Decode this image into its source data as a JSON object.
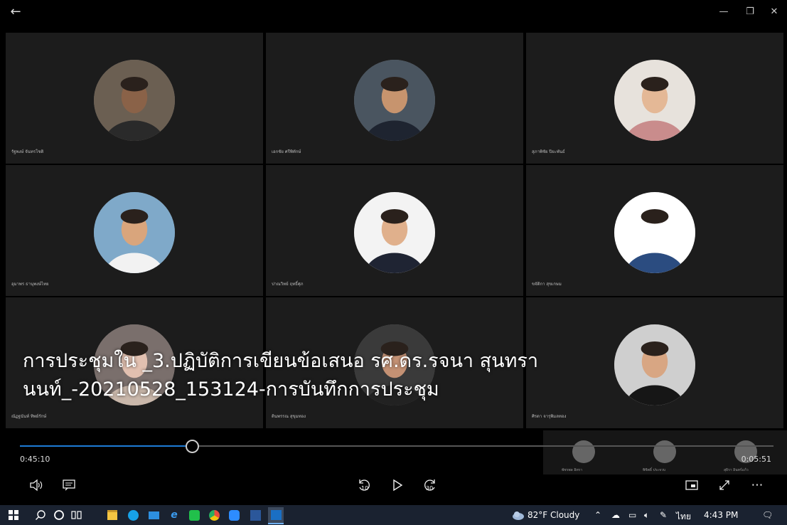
{
  "window": {
    "back_icon": "arrow-left-icon",
    "minimize_icon": "minimize-icon",
    "restore_icon": "restore-icon",
    "close_icon": "close-icon"
  },
  "participants": [
    {
      "name": "รัฐพงษ์ จันทรโชติ",
      "bg": "#6b5f52",
      "skin": "#8a6248",
      "shirt": "#2a2a2a"
    },
    {
      "name": "เอกชัย ศรีพิทักษ์",
      "bg": "#4a5560",
      "skin": "#c7946e",
      "shirt": "#1e2430"
    },
    {
      "name": "สุภาพิชัย ปิยะพันธ์",
      "bg": "#e7e2dc",
      "skin": "#e4b896",
      "shirt": "#c98c8c"
    },
    {
      "name": "อุมาพร ธานุพงษ์ไทย",
      "bg": "#7fa9c9",
      "skin": "#d9a57c",
      "shirt": "#f2f2f2"
    },
    {
      "name": "ปาณวิทย์ ฤทธิ์ศุภ",
      "bg": "#f3f3f3",
      "skin": "#e0b08c",
      "shirt": "#1f2433"
    },
    {
      "name": "ขจัติกา สุขเกษม",
      "bg": "#ffffff",
      "skin": "#ffffff",
      "shirt": "#2b4c80"
    },
    {
      "name": "ณัฏฐนันท์ ทิพย์รักษ์",
      "bg": "#7a6f6c",
      "skin": "#e2c0b0",
      "shirt": "#c9b7aa"
    },
    {
      "name": "ตินพรรณ สุขุมทอง",
      "bg": "#3a3a3a",
      "skin": "#c49174",
      "shirt": "#222"
    },
    {
      "name": "ศิรดา จารุพิมลทอง",
      "bg": "#cfcfcf",
      "skin": "#d8a683",
      "shirt": "#161616"
    }
  ],
  "video_title": "การประชุมใน _3.ปฏิบัติการเขียนข้อเสนอ รศ.ดร.รจนา สุนทรานนท์_-20210528_153124-การบันทึกการประชุม",
  "playback": {
    "current_time": "0:45:10",
    "remaining_time": "0:05:51",
    "progress": 0.228,
    "accent": "#1d7bd6"
  },
  "mini_thumbnails": [
    {
      "name": "พัชรพล อิทรา"
    },
    {
      "name": "พิชิตธิ์ ประจวบ"
    },
    {
      "name": "สุธิรา อินทร์แก้ว"
    }
  ],
  "controls": {
    "volume_icon": "volume-icon",
    "captions_icon": "captions-icon",
    "rewind_label": "10",
    "forward_label": "30",
    "play_icon": "play-icon",
    "miniview_icon": "mini-view-icon",
    "fullscreen_icon": "fullscreen-icon",
    "more_icon": "more-icon"
  },
  "taskbar": {
    "weather": "82°F  Cloudy",
    "language": "ไทย",
    "time": "4:43 PM"
  }
}
